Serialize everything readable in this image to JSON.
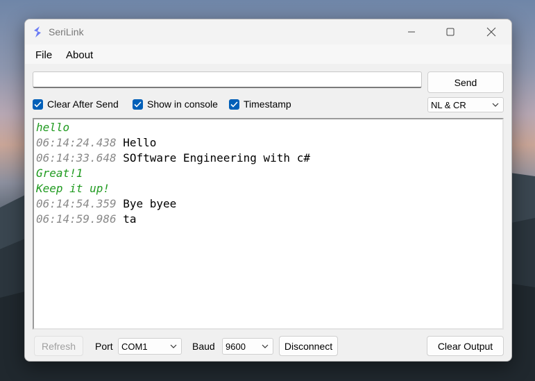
{
  "window": {
    "title": "SeriLink"
  },
  "menu": {
    "file": "File",
    "about": "About"
  },
  "send": {
    "input_value": "",
    "button_label": "Send"
  },
  "options": {
    "clear_after_send": {
      "label": "Clear After Send",
      "checked": true
    },
    "show_in_console": {
      "label": "Show in console",
      "checked": true
    },
    "timestamp": {
      "label": "Timestamp",
      "checked": true
    },
    "line_ending": "NL & CR"
  },
  "console": {
    "lines": [
      {
        "type": "echo",
        "text": "hello"
      },
      {
        "type": "received",
        "time": "06:14:24.438",
        "text": "Hello"
      },
      {
        "type": "received",
        "time": "06:14:33.648",
        "text": "SOftware Engineering with c#"
      },
      {
        "type": "echo",
        "text": "Great!1"
      },
      {
        "type": "echo",
        "text": "Keep it up!"
      },
      {
        "type": "received",
        "time": "06:14:54.359",
        "text": "Bye byee"
      },
      {
        "type": "received",
        "time": "06:14:59.986",
        "text": "ta"
      }
    ]
  },
  "footer": {
    "refresh_label": "Refresh",
    "port_label": "Port",
    "port_value": "COM1",
    "baud_label": "Baud",
    "baud_value": "9600",
    "disconnect_label": "Disconnect",
    "clear_output_label": "Clear Output"
  },
  "colors": {
    "accent": "#005fb8",
    "echo_text": "#1f9a1f",
    "timestamp_text": "#8a8a8a"
  }
}
